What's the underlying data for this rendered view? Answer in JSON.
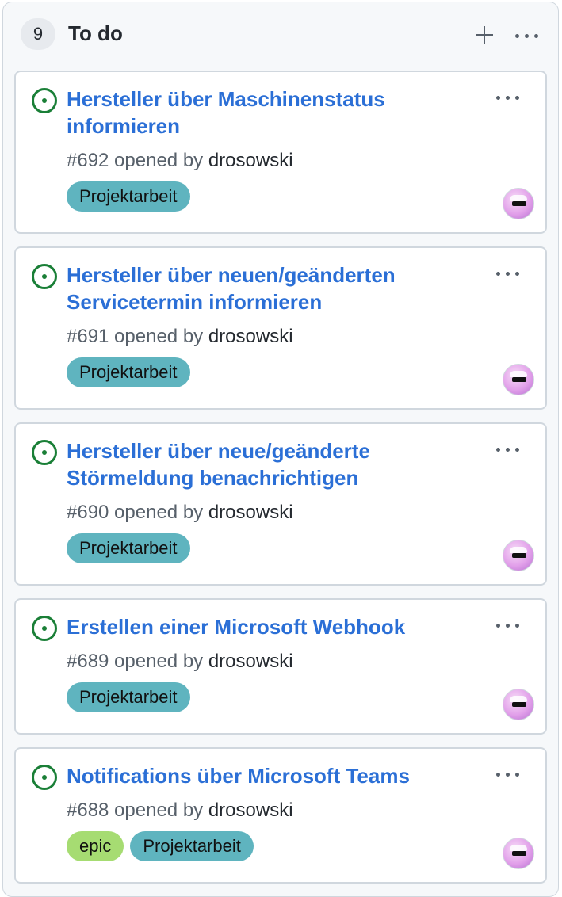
{
  "column": {
    "count": "9",
    "title": "To do"
  },
  "colors": {
    "issue_open": "#1a7f37",
    "title_link": "#2b6fd6",
    "label_projektarbeit": "#5fb4bf",
    "label_epic": "#a6dc72"
  },
  "icons": {
    "add": "plus-icon",
    "menu": "kebab-horizontal-icon",
    "issue": "issue-opened-icon"
  },
  "cards": [
    {
      "title": "Hersteller über Maschinenstatus informieren",
      "number": "#692",
      "opened_by_text": " opened by ",
      "author": "drosowski",
      "labels": [
        "Projektarbeit"
      ]
    },
    {
      "title": "Hersteller über neuen/geänderten Servicetermin informieren",
      "number": "#691",
      "opened_by_text": " opened by ",
      "author": "drosowski",
      "labels": [
        "Projektarbeit"
      ]
    },
    {
      "title": "Hersteller über neue/geänderte Störmeldung benachrichtigen",
      "number": "#690",
      "opened_by_text": " opened by ",
      "author": "drosowski",
      "labels": [
        "Projektarbeit"
      ]
    },
    {
      "title": "Erstellen einer Microsoft Webhook",
      "number": "#689",
      "opened_by_text": " opened by ",
      "author": "drosowski",
      "labels": [
        "Projektarbeit"
      ]
    },
    {
      "title": "Notifications über Microsoft Teams",
      "number": "#688",
      "opened_by_text": " opened by ",
      "author": "drosowski",
      "labels": [
        "epic",
        "Projektarbeit"
      ]
    }
  ]
}
